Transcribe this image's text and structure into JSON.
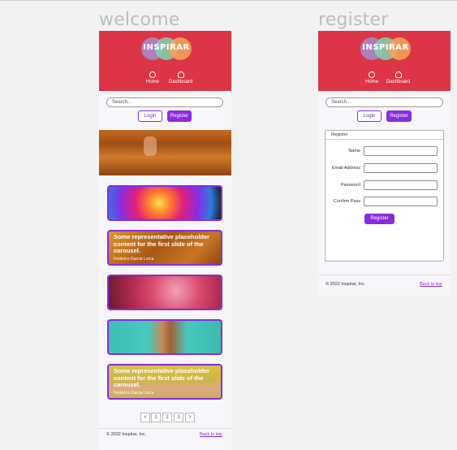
{
  "frames": {
    "welcome_title": "welcome",
    "register_title": "register"
  },
  "brand": {
    "logo_text": "INSPIRAR",
    "header_color": "#dc3545",
    "accent_color": "#8a2be2"
  },
  "nav": {
    "home_label": "Home",
    "dashboard_label": "Dashboard"
  },
  "search": {
    "placeholder": "Search..."
  },
  "auth": {
    "login_label": "Login",
    "register_label": "Register"
  },
  "carousel": [
    {
      "caption": "",
      "author": ""
    },
    {
      "caption": "Some representative placeholder content for the first slide of the carousel.",
      "author": "Federico Garcia Lorca"
    },
    {
      "caption": "",
      "author": ""
    },
    {
      "caption": "",
      "author": ""
    },
    {
      "caption": "Some representative placeholder content for the first slide of the carousel.",
      "author": "Federico Garcia Lorca"
    }
  ],
  "pagination": {
    "prev": "<",
    "pages": [
      "1",
      "2",
      "3"
    ],
    "next": ">"
  },
  "footer": {
    "copyright": "© 2022 Inspirar, Inc.",
    "back_to_top": "Back to top"
  },
  "register_form": {
    "title": "Register",
    "fields": [
      "Name",
      "Email Address",
      "Password",
      "Confirm Pass"
    ],
    "submit_label": "Register"
  }
}
